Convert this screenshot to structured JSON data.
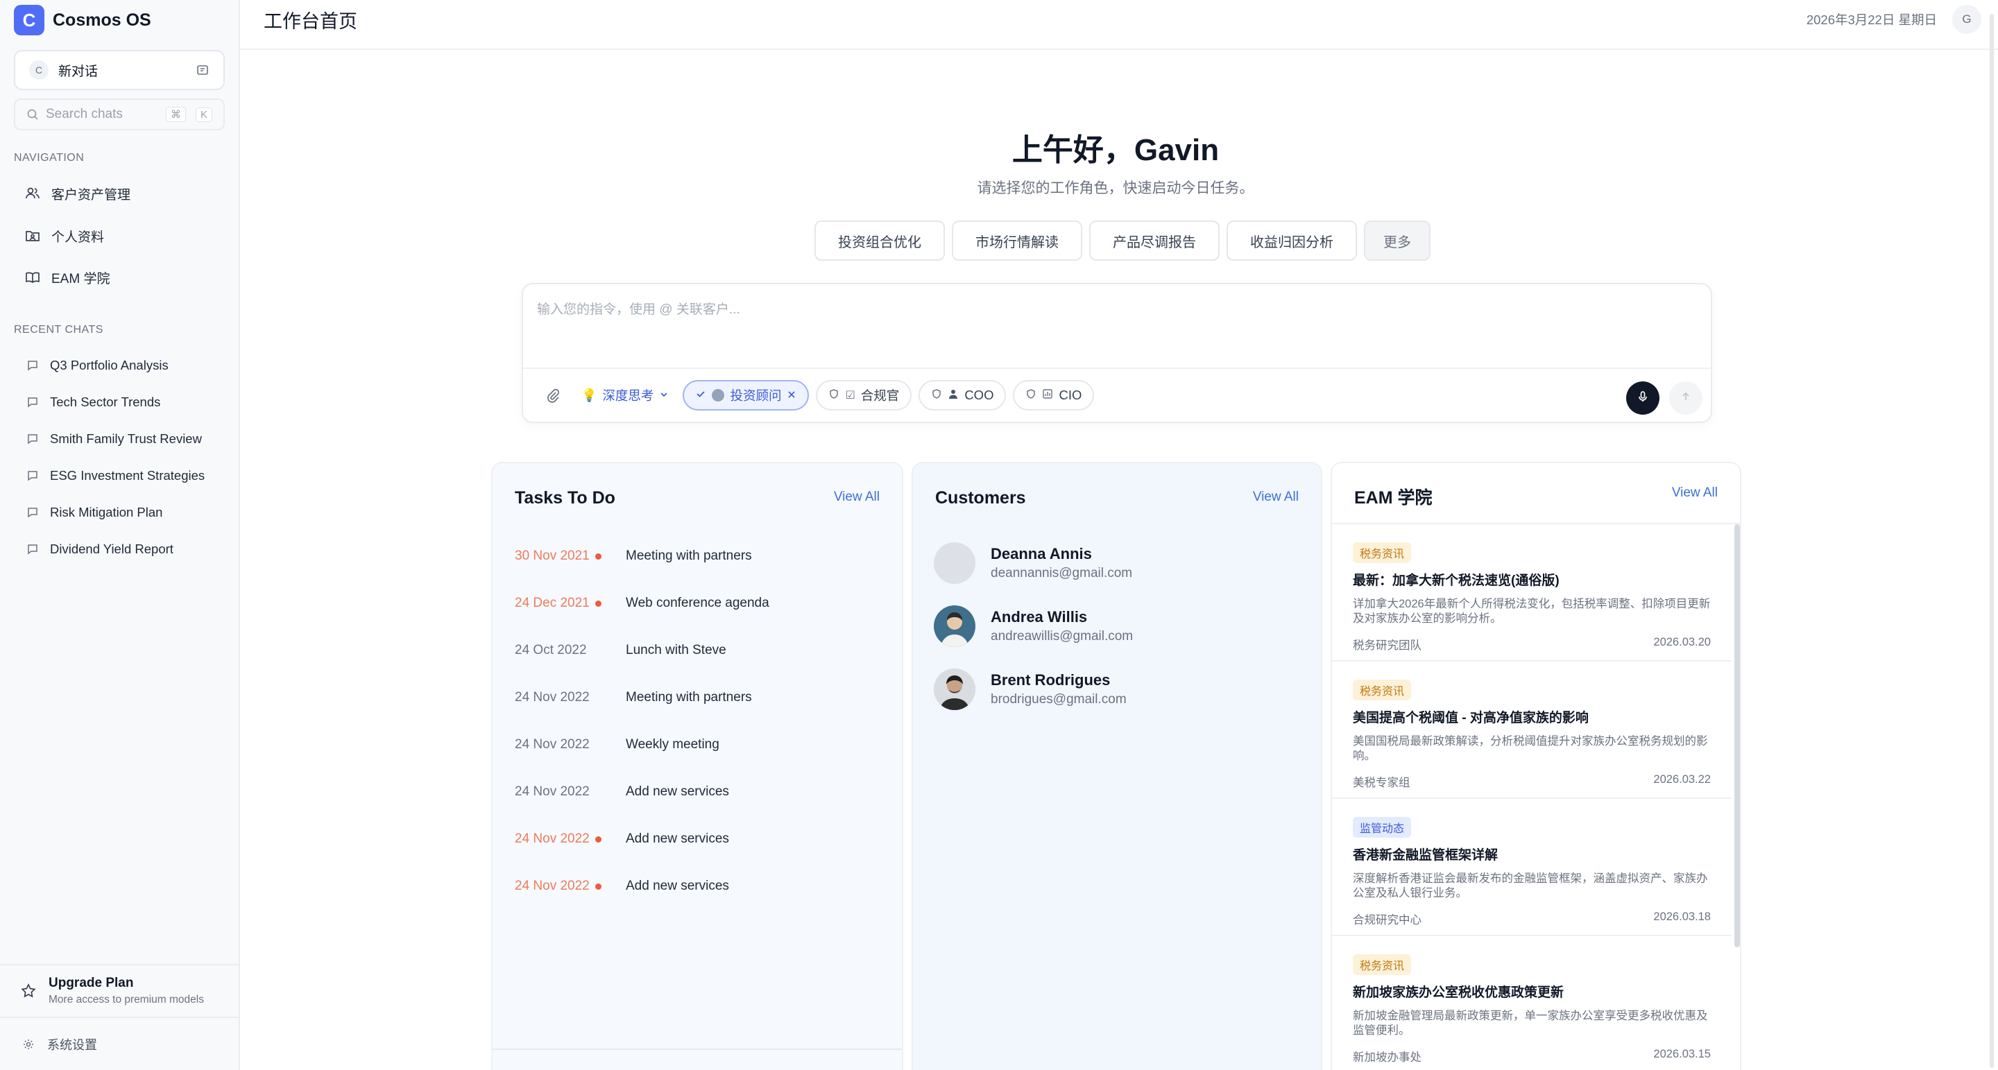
{
  "app": {
    "logo_letter": "C",
    "name": "Cosmos OS"
  },
  "sidebar": {
    "new_chat": {
      "avatar": "C",
      "label": "新对话"
    },
    "search": {
      "placeholder": "Search chats",
      "kbd1": "⌘",
      "kbd2": "K"
    },
    "nav_title": "NAVIGATION",
    "nav": [
      {
        "label": "客户资产管理",
        "icon": "users-icon"
      },
      {
        "label": "个人资料",
        "icon": "folder-user-icon"
      },
      {
        "label": "EAM 学院",
        "icon": "book-open-icon"
      }
    ],
    "recent_title": "RECENT CHATS",
    "recent": [
      "Q3 Portfolio Analysis",
      "Tech Sector Trends",
      "Smith Family Trust Review",
      "ESG Investment Strategies",
      "Risk Mitigation Plan",
      "Dividend Yield Report"
    ],
    "upgrade": {
      "title": "Upgrade Plan",
      "subtitle": "More access to premium models"
    },
    "settings": "系统设置"
  },
  "header": {
    "title": "工作台首页",
    "date": "2026年3月22日 星期日",
    "user_initial": "G"
  },
  "hero": {
    "greeting": "上午好，Gavin",
    "subtitle": "请选择您的工作角色，快速启动今日任务。",
    "quick_actions": [
      "投资组合优化",
      "市场行情解读",
      "产品尽调报告",
      "收益归因分析"
    ],
    "more": "更多"
  },
  "composer": {
    "placeholder": "输入您的指令，使用 @ 关联客户...",
    "deep_think": "深度思考",
    "roles": [
      {
        "label": "投资顾问",
        "prefix": "",
        "active": true
      },
      {
        "label": "合规官",
        "prefix": "☑",
        "active": false
      },
      {
        "label": "COO",
        "prefix": "",
        "active": false
      },
      {
        "label": "CIO",
        "prefix": "",
        "active": false
      }
    ]
  },
  "tasks": {
    "title": "Tasks To Do",
    "view_all": "View All",
    "items": [
      {
        "date": "30 Nov 2021",
        "name": "Meeting with partners",
        "urgent": true
      },
      {
        "date": "24 Dec 2021",
        "name": "Web conference agenda",
        "urgent": true
      },
      {
        "date": "24 Oct 2022",
        "name": "Lunch with Steve",
        "urgent": false
      },
      {
        "date": "24 Nov 2022",
        "name": "Meeting with partners",
        "urgent": false
      },
      {
        "date": "24 Nov 2022",
        "name": "Weekly meeting",
        "urgent": false
      },
      {
        "date": "24 Nov 2022",
        "name": "Add new services",
        "urgent": false
      },
      {
        "date": "24 Nov 2022",
        "name": "Add new services",
        "urgent": true
      },
      {
        "date": "24 Nov 2022",
        "name": "Add new services",
        "urgent": true
      }
    ]
  },
  "customers": {
    "title": "Customers",
    "view_all": "View All",
    "items": [
      {
        "name": "Deanna Annis",
        "email": "deannannis@gmail.com"
      },
      {
        "name": "Andrea Willis",
        "email": "andreawillis@gmail.com"
      },
      {
        "name": "Brent Rodrigues",
        "email": "brodrigues@gmail.com"
      }
    ]
  },
  "eam": {
    "title": "EAM 学院",
    "view_all": "View All",
    "items": [
      {
        "tag": "税务资讯",
        "tag_type": "tax",
        "title": "最新：加拿大新个税法速览(通俗版)",
        "desc": "详加拿大2026年最新个人所得税法变化，包括税率调整、扣除项目更新及对家族办公室的影响分析。",
        "author": "税务研究团队",
        "date": "2026.03.20"
      },
      {
        "tag": "税务资讯",
        "tag_type": "tax",
        "title": "美国提高个税阈值 - 对高净值家族的影响",
        "desc": "美国国税局最新政策解读，分析税阈值提升对家族办公室税务规划的影响。",
        "author": "美税专家组",
        "date": "2026.03.22"
      },
      {
        "tag": "监管动态",
        "tag_type": "reg",
        "title": "香港新金融监管框架详解",
        "desc": "深度解析香港证监会最新发布的金融监管框架，涵盖虚拟资产、家族办公室及私人银行业务。",
        "author": "合规研究中心",
        "date": "2026.03.18"
      },
      {
        "tag": "税务资讯",
        "tag_type": "tax",
        "title": "新加坡家族办公室税收优惠政策更新",
        "desc": "新加坡金融管理局最新政策更新，单一家族办公室享受更多税收优惠及监管便利。",
        "author": "新加坡办事处",
        "date": "2026.03.15"
      }
    ]
  },
  "colors": {
    "brand": "#4f6df5",
    "accent_link": "#3b6fd9",
    "urgent": "#ef7a5a"
  }
}
